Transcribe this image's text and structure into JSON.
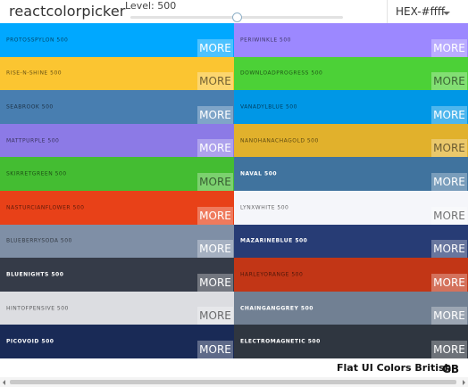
{
  "header": {
    "logo": "reactcolorpicker",
    "level_label": "Level: 500",
    "slider_level_percent": 50,
    "format_label": "HEX-#ffff"
  },
  "palette_name": "Flat UI Colors British",
  "palette_code": "GB",
  "swatches": [
    {
      "name": "PROTOSSPYLON 500",
      "more": "MORE",
      "color": "#00a8ff",
      "text": "dark"
    },
    {
      "name": "PERIWINKLE 500",
      "more": "MORE",
      "color": "#9c88ff",
      "text": "dark"
    },
    {
      "name": "RISE-N-SHINE 500",
      "more": "MORE",
      "color": "#fbc531",
      "text": "dark"
    },
    {
      "name": "DOWNLOADPROGRESS 500",
      "more": "MORE",
      "color": "#4cd137",
      "text": "dark"
    },
    {
      "name": "SEABROOK 500",
      "more": "MORE",
      "color": "#487eb0",
      "text": "dark"
    },
    {
      "name": "VANADYLBLUE 500",
      "more": "MORE",
      "color": "#0097e6",
      "text": "dark"
    },
    {
      "name": "MATTPURPLE 500",
      "more": "MORE",
      "color": "#8c7ae6",
      "text": "dark"
    },
    {
      "name": "NANOHANACHAGOLD 500",
      "more": "MORE",
      "color": "#e1b12c",
      "text": "dark"
    },
    {
      "name": "SKIRRETGREEN 500",
      "more": "MORE",
      "color": "#44bd32",
      "text": "dark"
    },
    {
      "name": "NAVAL 500",
      "more": "MORE",
      "color": "#40739e",
      "text": "light"
    },
    {
      "name": "NASTURCIANFLOWER 500",
      "more": "MORE",
      "color": "#e84118",
      "text": "dark"
    },
    {
      "name": "LYNXWHITE 500",
      "more": "MORE",
      "color": "#f5f6fa",
      "text": "dark"
    },
    {
      "name": "BLUEBERRYSODA 500",
      "more": "MORE",
      "color": "#7f8fa6",
      "text": "dark"
    },
    {
      "name": "MAZARINEBLUE 500",
      "more": "MORE",
      "color": "#273c75",
      "text": "light"
    },
    {
      "name": "BLUENIGHTS 500",
      "more": "MORE",
      "color": "#353b48",
      "text": "light"
    },
    {
      "name": "HARLEYORANGE 500",
      "more": "MORE",
      "color": "#c23616",
      "text": "dark"
    },
    {
      "name": "HINTOFPENSIVE 500",
      "more": "MORE",
      "color": "#dcdde1",
      "text": "dark"
    },
    {
      "name": "CHAINGANGGREY 500",
      "more": "MORE",
      "color": "#718093",
      "text": "light"
    },
    {
      "name": "PICOVOID 500",
      "more": "MORE",
      "color": "#192a56",
      "text": "light"
    },
    {
      "name": "ELECTROMAGNETIC 500",
      "more": "MORE",
      "color": "#2f3640",
      "text": "light"
    }
  ]
}
